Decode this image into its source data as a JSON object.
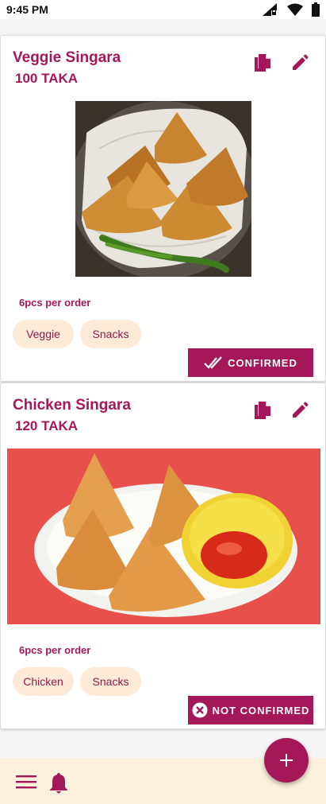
{
  "status_bar": {
    "time": "9:45 PM"
  },
  "colors": {
    "accent": "#a4185a",
    "chip_bg": "#fdebd8",
    "bottom_bar_bg": "#fdf0dc"
  },
  "items": [
    {
      "title": "Veggie Singara",
      "price": "100 TAKA",
      "note": "6pcs per order",
      "tags": [
        "Veggie",
        "Snacks"
      ],
      "status_label": "CONFIRMED",
      "status_icon": "double-check-icon"
    },
    {
      "title": "Chicken Singara",
      "price": "120 TAKA",
      "note": "6pcs per order",
      "tags": [
        "Chicken",
        "Snacks"
      ],
      "status_label": "NOT CONFIRMED",
      "status_icon": "cancel-circle-icon"
    }
  ],
  "bottom_bar": {
    "menu_icon": "menu-icon",
    "notification_icon": "bell-icon"
  },
  "fab": {
    "icon": "plus-icon"
  }
}
